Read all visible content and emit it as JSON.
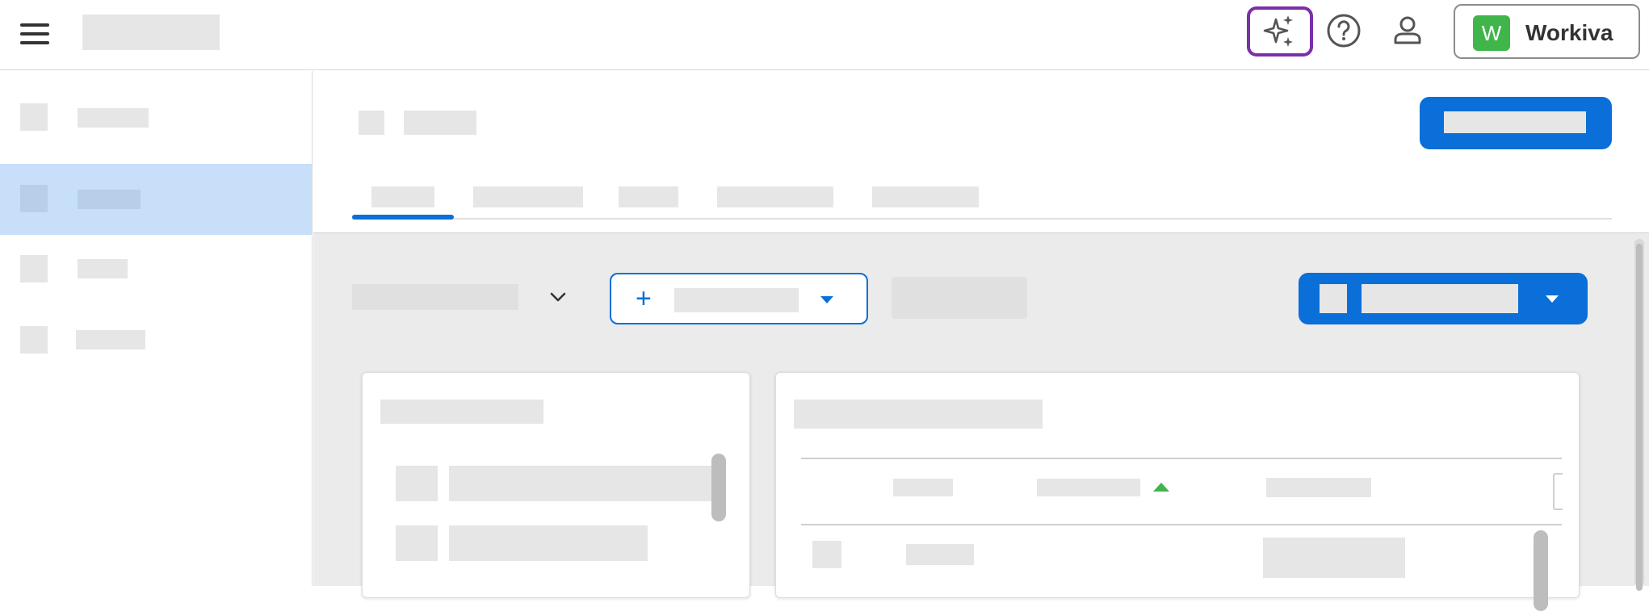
{
  "header": {
    "menu_icon": "hamburger-menu-icon",
    "ai_icon": "sparkle-icon",
    "help_icon": "help-circle-icon",
    "user_icon": "user-profile-icon",
    "workspace": {
      "avatar_letter": "W",
      "label": "Workiva",
      "avatar_color": "#3fb54a"
    }
  },
  "colors": {
    "accent": "#0a6fd8",
    "ai_highlight": "#7b2fa8",
    "sidebar_active": "#c8dffa",
    "placeholder": "#e6e6e6",
    "sort_indicator": "#3fb54a"
  },
  "sidebar": {
    "items": [
      {
        "icon": "placeholder-icon",
        "active": false
      },
      {
        "icon": "placeholder-icon",
        "active": true
      },
      {
        "icon": "placeholder-icon",
        "active": false
      },
      {
        "icon": "placeholder-icon",
        "active": false
      }
    ]
  },
  "main": {
    "add_button_icon": "plus-icon",
    "select_icon": "chevron-down-icon",
    "active_tab_index": 0,
    "table_sort_icon": "sort-ascending-icon"
  }
}
